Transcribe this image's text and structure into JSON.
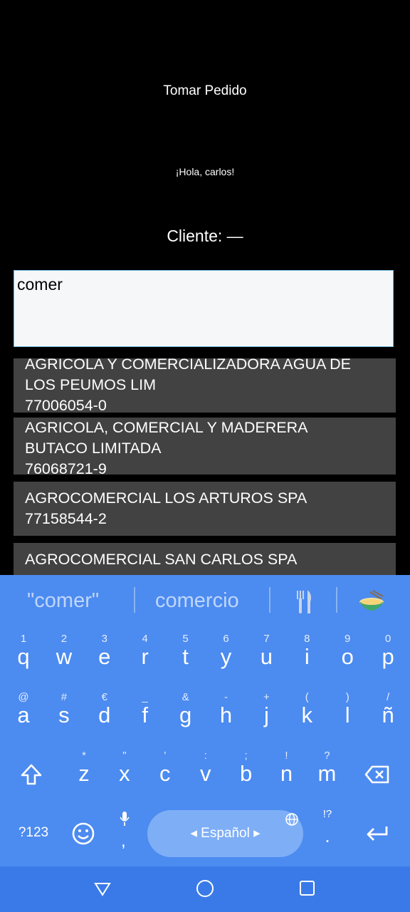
{
  "header": {
    "title": "Tomar Pedido",
    "greeting": "¡Hola, carlos!",
    "cliente": "Cliente: —"
  },
  "search": {
    "value": "comer"
  },
  "results": [
    {
      "name": "AGRICOLA Y COMERCIALIZADORA AGUA DE",
      "name2": "LOS PEUMOS LIM",
      "rut": "77006054-0"
    },
    {
      "name": "AGRICOLA, COMERCIAL Y MADERERA",
      "name2": "BUTACO LIMITADA",
      "rut": "76068721-9"
    },
    {
      "name": "AGROCOMERCIAL LOS ARTUROS SPA",
      "name2": "",
      "rut": "77158544-2"
    },
    {
      "name": "AGROCOMERCIAL SAN CARLOS SPA",
      "name2": "",
      "rut": ""
    }
  ],
  "keyboard": {
    "suggestions": [
      "\"comer\"",
      "comercio"
    ],
    "row1": [
      {
        "k": "q",
        "h": "1"
      },
      {
        "k": "w",
        "h": "2"
      },
      {
        "k": "e",
        "h": "3"
      },
      {
        "k": "r",
        "h": "4"
      },
      {
        "k": "t",
        "h": "5"
      },
      {
        "k": "y",
        "h": "6"
      },
      {
        "k": "u",
        "h": "7"
      },
      {
        "k": "i",
        "h": "8"
      },
      {
        "k": "o",
        "h": "9"
      },
      {
        "k": "p",
        "h": "0"
      }
    ],
    "row2": [
      {
        "k": "a",
        "h": "@"
      },
      {
        "k": "s",
        "h": "#"
      },
      {
        "k": "d",
        "h": "€"
      },
      {
        "k": "f",
        "h": "_"
      },
      {
        "k": "g",
        "h": "&"
      },
      {
        "k": "h",
        "h": "-"
      },
      {
        "k": "j",
        "h": "+"
      },
      {
        "k": "k",
        "h": "("
      },
      {
        "k": "l",
        "h": ")"
      },
      {
        "k": "ñ",
        "h": "/"
      }
    ],
    "row3": [
      {
        "k": "z",
        "h": "*"
      },
      {
        "k": "x",
        "h": "\""
      },
      {
        "k": "c",
        "h": "'"
      },
      {
        "k": "v",
        "h": ":"
      },
      {
        "k": "b",
        "h": ";"
      },
      {
        "k": "n",
        "h": "!"
      },
      {
        "k": "m",
        "h": "?"
      }
    ],
    "symbols_label": "?123",
    "space_label": "Español",
    "comma": ",",
    "period": ".",
    "period_hint": "!?",
    "colors": {
      "background": "#4c8bf0",
      "space": "#7eaef6",
      "navbar": "#3a7ae8"
    }
  }
}
